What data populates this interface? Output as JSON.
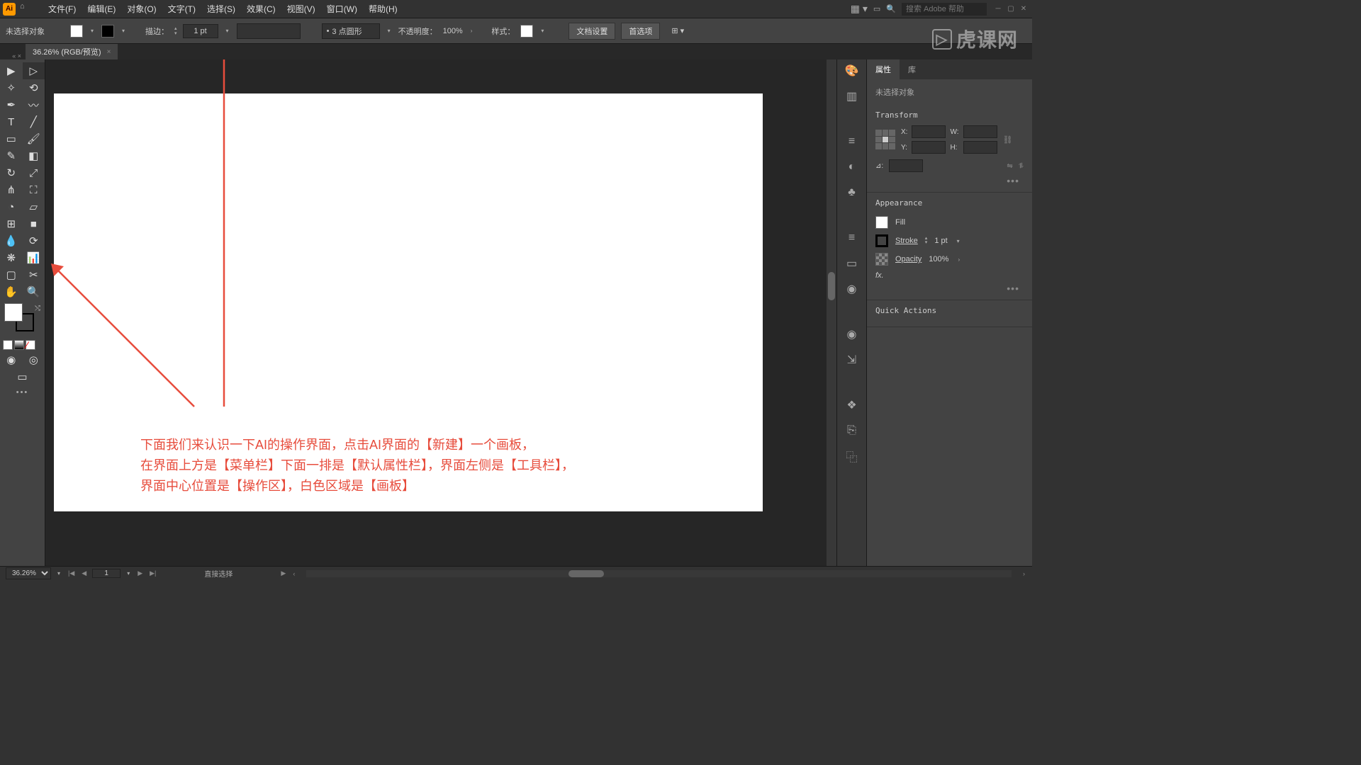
{
  "menubar": {
    "items": [
      "文件(F)",
      "编辑(E)",
      "对象(O)",
      "文字(T)",
      "选择(S)",
      "效果(C)",
      "视图(V)",
      "窗口(W)",
      "帮助(H)"
    ],
    "search_placeholder": "搜索 Adobe 帮助"
  },
  "optionsbar": {
    "no_selection": "未选择对象",
    "stroke_label": "描边：",
    "stroke_value": "1 pt",
    "brush_style": "3 点圆形",
    "opacity_label": "不透明度：",
    "opacity_value": "100%",
    "style_label": "样式：",
    "doc_setup": "文档设置",
    "prefs": "首选项"
  },
  "doctab": {
    "title": "36.26% (RGB/预览)",
    "close": "×"
  },
  "annotation": {
    "line1": "下面我们来认识一下AI的操作界面，点击AI界面的【新建】一个画板，",
    "line2": "在界面上方是【菜单栏】下面一排是【默认属性栏】，界面左侧是【工具栏】，",
    "line3": "界面中心位置是【操作区】，白色区域是【画板】"
  },
  "props": {
    "tab_props": "属性",
    "tab_lib": "库",
    "no_selection": "未选择对象",
    "transform_title": "Transform",
    "x_label": "X:",
    "y_label": "Y:",
    "w_label": "W:",
    "h_label": "H:",
    "angle_label": "⊿:",
    "appearance_title": "Appearance",
    "fill_label": "Fill",
    "stroke_label": "Stroke",
    "stroke_value": "1 pt",
    "opacity_label": "Opacity",
    "opacity_value": "100%",
    "fx_label": "fx.",
    "quick_actions": "Quick Actions"
  },
  "statusbar": {
    "zoom": "36.26%",
    "artboard": "1",
    "tool": "直接选择"
  },
  "watermark": {
    "box": "▷",
    "text": "虎课网"
  }
}
